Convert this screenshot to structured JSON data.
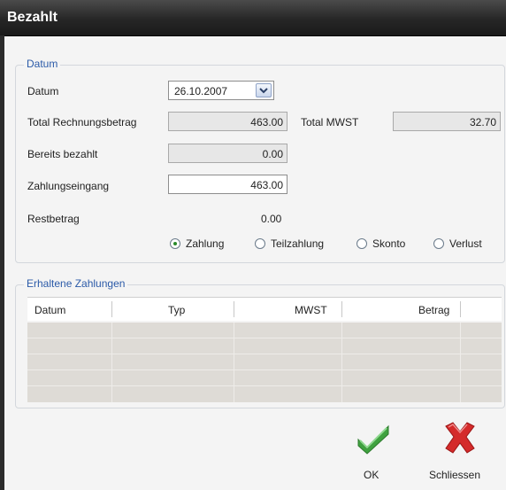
{
  "window": {
    "title": "Bezahlt"
  },
  "datum_group": {
    "legend": "Datum",
    "datum_label": "Datum",
    "datum_value": "26.10.2007",
    "total_rechnungsbetrag_label": "Total Rechnungsbetrag",
    "total_rechnungsbetrag_value": "463.00",
    "total_mwst_label": "Total MWST",
    "total_mwst_value": "32.70",
    "bereits_bezahlt_label": "Bereits bezahlt",
    "bereits_bezahlt_value": "0.00",
    "zahlungseingang_label": "Zahlungseingang",
    "zahlungseingang_value": "463.00",
    "restbetrag_label": "Restbetrag",
    "restbetrag_value": "0.00",
    "payment_types": [
      {
        "label": "Zahlung",
        "checked": true
      },
      {
        "label": "Teilzahlung",
        "checked": false
      },
      {
        "label": "Skonto",
        "checked": false
      },
      {
        "label": "Verlust",
        "checked": false
      }
    ]
  },
  "payments_group": {
    "legend": "Erhaltene Zahlungen",
    "columns": [
      "Datum",
      "Typ",
      "MWST",
      "Betrag"
    ],
    "rows": []
  },
  "actions": {
    "ok_label": "OK",
    "close_label": "Schliessen",
    "ok_icon": "checkmark-icon",
    "close_icon": "red-x-icon"
  },
  "colors": {
    "legend_blue": "#2b5aa8",
    "check_green": "#3fa23f",
    "close_red": "#d42a2a"
  }
}
